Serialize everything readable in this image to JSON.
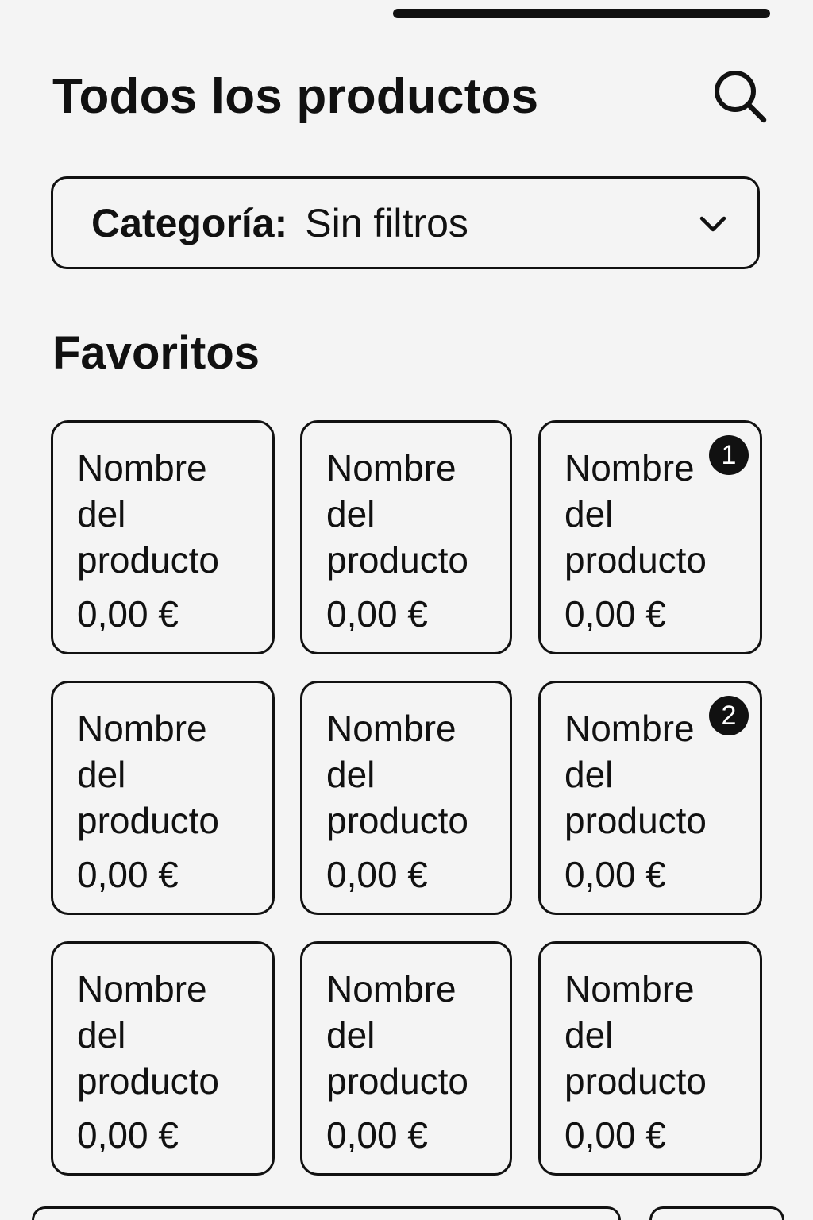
{
  "header": {
    "title": "Todos los productos",
    "search_icon": "search-icon"
  },
  "filter": {
    "label": "Categoría:",
    "value": "Sin filtros",
    "icon": "chevron-down-icon"
  },
  "favorites": {
    "title": "Favoritos",
    "products": [
      {
        "name": "Nombre del producto",
        "price": "0,00 €"
      },
      {
        "name": "Nombre del producto",
        "price": "0,00 €"
      },
      {
        "name": "Nombre del producto",
        "price": "0,00 €",
        "badge": "1"
      },
      {
        "name": "Nombre del producto",
        "price": "0,00 €"
      },
      {
        "name": "Nombre del producto",
        "price": "0,00 €"
      },
      {
        "name": "Nombre del producto",
        "price": "0,00 €",
        "badge": "2"
      },
      {
        "name": "Nombre del producto",
        "price": "0,00 €"
      },
      {
        "name": "Nombre del producto",
        "price": "0,00 €"
      },
      {
        "name": "Nombre del producto",
        "price": "0,00 €"
      }
    ]
  },
  "colors": {
    "background": "#f4f4f4",
    "foreground": "#111111",
    "badge_text": "#ffffff"
  }
}
